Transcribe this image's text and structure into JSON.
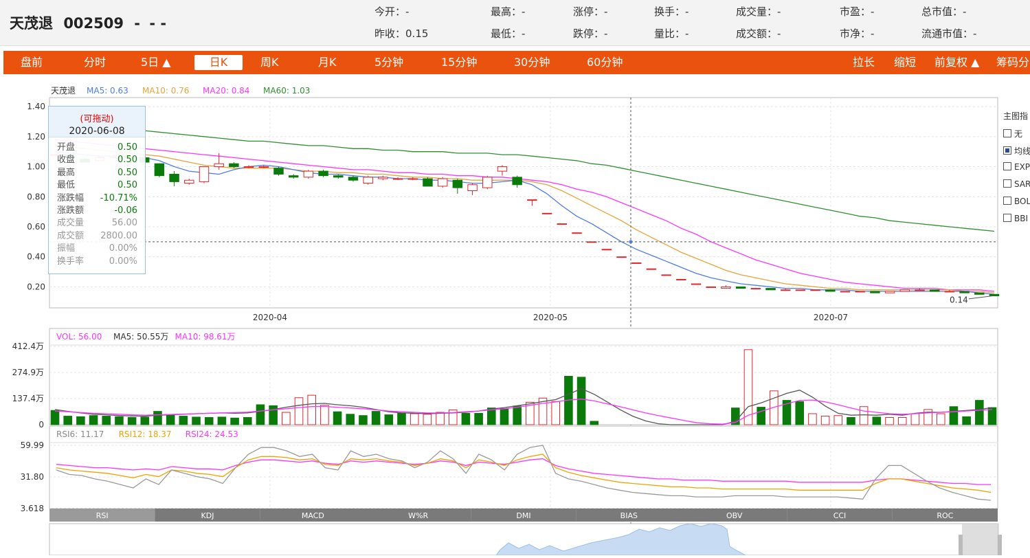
{
  "header": {
    "name": "天茂退",
    "code": "002509",
    "price": "- ",
    "change": "- -",
    "stats": [
      {
        "label": "今开：",
        "value": "-"
      },
      {
        "label": "昨收：",
        "value": "0.15"
      },
      {
        "label": "最高：",
        "value": "-"
      },
      {
        "label": "最低：",
        "value": "-"
      },
      {
        "label": "涨停：",
        "value": "-"
      },
      {
        "label": "跌停：",
        "value": "-"
      },
      {
        "label": "换手：",
        "value": "-"
      },
      {
        "label": "量比：",
        "value": "-"
      },
      {
        "label": "成交量：",
        "value": "-"
      },
      {
        "label": "成交额：",
        "value": "-"
      },
      {
        "label": "市盈：",
        "value": "-"
      },
      {
        "label": "市净：",
        "value": "-"
      },
      {
        "label": "总市值：",
        "value": "-"
      },
      {
        "label": "流通市值：",
        "value": "-"
      }
    ]
  },
  "toolbar": {
    "left": [
      "盘前",
      "分时",
      "5日 ▲",
      "日K",
      "周K",
      "月K",
      "5分钟",
      "15分钟",
      "30分钟",
      "60分钟"
    ],
    "right": [
      "拉长",
      "缩短",
      "前复权 ▲",
      "筹码分"
    ],
    "active": "日K"
  },
  "main_legend": {
    "name": "天茂退",
    "items": [
      {
        "text": "MA5: 0.63",
        "color": "#4d7ce8"
      },
      {
        "text": "MA10: 0.76",
        "color": "#e8a33a"
      },
      {
        "text": "MA20: 0.84",
        "color": "#ff33ff"
      },
      {
        "text": "MA60: 1.03",
        "color": "#2f8f2f"
      }
    ]
  },
  "price_axis": [
    "1.40",
    "1.20",
    "1.00",
    "0.80",
    "0.60",
    "0.40",
    "0.20"
  ],
  "date_axis": [
    "2020-04",
    "2020-05",
    "2020-07"
  ],
  "min_label": "0.14",
  "tooltip": {
    "drag": "(可拖动)",
    "date": "2020-06-08",
    "rows": [
      {
        "label": "开盘",
        "value": "0.50",
        "tone": "down"
      },
      {
        "label": "收盘",
        "value": "0.50",
        "tone": "down"
      },
      {
        "label": "最高",
        "value": "0.50",
        "tone": "down"
      },
      {
        "label": "最低",
        "value": "0.50",
        "tone": "down"
      },
      {
        "label": "涨跌幅",
        "value": "-10.71%",
        "tone": "down"
      },
      {
        "label": "涨跌额",
        "value": "-0.06",
        "tone": "down"
      },
      {
        "label": "成交量",
        "value": "56.00",
        "tone": "dim"
      },
      {
        "label": "成交额",
        "value": "2800.00",
        "tone": "dim"
      },
      {
        "label": "振幅",
        "value": "0.00%",
        "tone": "dim"
      },
      {
        "label": "换手率",
        "value": "0.00%",
        "tone": "dim"
      }
    ]
  },
  "side_panel": {
    "title": "主图指",
    "items": [
      {
        "label": "无",
        "checked": false
      },
      {
        "label": "均线",
        "checked": true
      },
      {
        "label": "EXPMA",
        "checked": false
      },
      {
        "label": "SAR",
        "checked": false
      },
      {
        "label": "BOLL",
        "checked": false
      },
      {
        "label": "BBI",
        "checked": false
      }
    ]
  },
  "vol_legend": [
    {
      "text": "VOL: 56.00",
      "color": "#ff33ff"
    },
    {
      "text": "MA5: 50.55万",
      "color": "#333333"
    },
    {
      "text": "MA10: 98.61万",
      "color": "#ff33ff"
    }
  ],
  "vol_axis": [
    "412.4万",
    "274.9万",
    "137.4万",
    "0"
  ],
  "rsi_legend": [
    {
      "text": "RSI6: 11.17",
      "color": "#888888"
    },
    {
      "text": "RSI12: 18.37",
      "color": "#f0a300"
    },
    {
      "text": "RSI24: 24.53",
      "color": "#ff33ff"
    }
  ],
  "rsi_axis": [
    "59.99",
    "31.80",
    "3.618"
  ],
  "indicator_tabs": [
    "RSI",
    "KDJ",
    "MACD",
    "W%R",
    "DMI",
    "BIAS",
    "OBV",
    "CCI",
    "ROC"
  ],
  "active_indicator": "RSI",
  "colors": {
    "up": "#e0262b",
    "down": "#0a7a0a",
    "accent": "#e9530d"
  },
  "chart_data": {
    "type": "candlestick",
    "dates_visible": [
      "2020-04",
      "2020-05",
      "2020-07"
    ],
    "ohlc": [
      [
        1.08,
        1.08,
        1.08,
        1.08
      ],
      [
        1.07,
        1.06,
        1.08,
        1.06
      ],
      [
        1.05,
        1.03,
        1.06,
        1.03
      ],
      [
        1.04,
        1.06,
        1.07,
        1.04
      ],
      [
        1.06,
        1.07,
        1.08,
        1.06
      ],
      [
        1.07,
        1.06,
        1.08,
        1.06
      ],
      [
        1.06,
        1.03,
        1.07,
        1.03
      ],
      [
        1.02,
        0.94,
        1.02,
        0.93
      ],
      [
        0.95,
        0.9,
        0.97,
        0.87
      ],
      [
        0.89,
        0.91,
        0.92,
        0.88
      ],
      [
        0.9,
        1.0,
        1.0,
        0.89
      ],
      [
        1.0,
        1.02,
        1.09,
        0.98
      ],
      [
        1.02,
        1.0,
        1.03,
        0.99
      ],
      [
        1.0,
        1.0,
        1.01,
        0.99
      ],
      [
        1.0,
        1.0,
        1.01,
        0.99
      ],
      [
        0.99,
        0.95,
        1.0,
        0.94
      ],
      [
        0.94,
        0.93,
        0.95,
        0.92
      ],
      [
        0.93,
        0.97,
        0.98,
        0.92
      ],
      [
        0.97,
        0.94,
        0.98,
        0.93
      ],
      [
        0.94,
        0.93,
        0.95,
        0.92
      ],
      [
        0.93,
        0.91,
        0.94,
        0.9
      ],
      [
        0.89,
        0.93,
        0.94,
        0.88
      ],
      [
        0.92,
        0.93,
        0.94,
        0.91
      ],
      [
        0.92,
        0.92,
        0.93,
        0.91
      ],
      [
        0.92,
        0.92,
        0.93,
        0.91
      ],
      [
        0.92,
        0.87,
        0.93,
        0.87
      ],
      [
        0.87,
        0.92,
        0.93,
        0.86
      ],
      [
        0.91,
        0.86,
        0.92,
        0.82
      ],
      [
        0.84,
        0.88,
        0.89,
        0.81
      ],
      [
        0.86,
        0.93,
        0.94,
        0.85
      ],
      [
        0.97,
        1.0,
        1.01,
        0.94
      ],
      [
        0.93,
        0.88,
        0.94,
        0.86
      ],
      [
        0.78,
        0.78,
        0.78,
        0.74
      ],
      [
        0.69,
        0.69,
        0.69,
        0.69
      ],
      [
        0.62,
        0.62,
        0.62,
        0.62
      ],
      [
        0.56,
        0.56,
        0.56,
        0.56
      ],
      [
        0.5,
        0.5,
        0.5,
        0.5
      ],
      [
        0.45,
        0.45,
        0.45,
        0.45
      ],
      [
        0.4,
        0.4,
        0.4,
        0.4
      ],
      [
        0.36,
        0.36,
        0.36,
        0.36
      ],
      [
        0.32,
        0.32,
        0.32,
        0.32
      ],
      [
        0.28,
        0.28,
        0.28,
        0.28
      ],
      [
        0.25,
        0.25,
        0.25,
        0.25
      ],
      [
        0.22,
        0.22,
        0.22,
        0.22
      ],
      [
        0.2,
        0.2,
        0.2,
        0.2
      ],
      [
        0.19,
        0.2,
        0.21,
        0.19
      ],
      [
        0.2,
        0.19,
        0.2,
        0.19
      ],
      [
        0.19,
        0.19,
        0.19,
        0.19
      ],
      [
        0.19,
        0.18,
        0.19,
        0.18
      ],
      [
        0.18,
        0.18,
        0.19,
        0.18
      ],
      [
        0.18,
        0.18,
        0.18,
        0.18
      ],
      [
        0.18,
        0.18,
        0.18,
        0.18
      ],
      [
        0.18,
        0.17,
        0.18,
        0.17
      ],
      [
        0.17,
        0.17,
        0.17,
        0.17
      ],
      [
        0.17,
        0.17,
        0.17,
        0.17
      ],
      [
        0.17,
        0.16,
        0.17,
        0.16
      ],
      [
        0.16,
        0.17,
        0.17,
        0.16
      ],
      [
        0.17,
        0.18,
        0.18,
        0.17
      ],
      [
        0.18,
        0.18,
        0.19,
        0.18
      ],
      [
        0.18,
        0.17,
        0.18,
        0.17
      ],
      [
        0.17,
        0.17,
        0.18,
        0.17
      ],
      [
        0.17,
        0.16,
        0.17,
        0.16
      ],
      [
        0.16,
        0.15,
        0.16,
        0.15
      ],
      [
        0.15,
        0.14,
        0.15,
        0.14
      ]
    ],
    "ma5": [
      1.1,
      1.09,
      1.08,
      1.07,
      1.07,
      1.06,
      1.06,
      1.04,
      1.0,
      0.97,
      0.96,
      0.95,
      0.98,
      1.0,
      1.01,
      1.0,
      0.98,
      0.96,
      0.95,
      0.95,
      0.94,
      0.93,
      0.93,
      0.92,
      0.92,
      0.91,
      0.91,
      0.9,
      0.89,
      0.89,
      0.9,
      0.91,
      0.88,
      0.82,
      0.74,
      0.67,
      0.62,
      0.56,
      0.5,
      0.45,
      0.41,
      0.37,
      0.33,
      0.29,
      0.26,
      0.24,
      0.22,
      0.21,
      0.2,
      0.19,
      0.19,
      0.18,
      0.18,
      0.18,
      0.17,
      0.17,
      0.17,
      0.17,
      0.17,
      0.17,
      0.17,
      0.17,
      0.16,
      0.15
    ],
    "ma10": [
      1.14,
      1.13,
      1.12,
      1.11,
      1.1,
      1.09,
      1.08,
      1.07,
      1.05,
      1.03,
      1.01,
      1.0,
      0.99,
      0.99,
      0.99,
      0.99,
      0.98,
      0.97,
      0.97,
      0.96,
      0.96,
      0.95,
      0.95,
      0.94,
      0.93,
      0.93,
      0.92,
      0.92,
      0.91,
      0.91,
      0.91,
      0.91,
      0.9,
      0.88,
      0.84,
      0.79,
      0.74,
      0.69,
      0.64,
      0.58,
      0.53,
      0.48,
      0.43,
      0.39,
      0.35,
      0.31,
      0.28,
      0.26,
      0.24,
      0.22,
      0.21,
      0.2,
      0.19,
      0.19,
      0.18,
      0.18,
      0.18,
      0.18,
      0.18,
      0.18,
      0.18,
      0.17,
      0.17,
      0.16
    ],
    "ma20": [
      1.18,
      1.17,
      1.16,
      1.15,
      1.14,
      1.13,
      1.12,
      1.11,
      1.1,
      1.09,
      1.08,
      1.07,
      1.06,
      1.05,
      1.04,
      1.03,
      1.02,
      1.01,
      1.0,
      0.99,
      0.98,
      0.98,
      0.97,
      0.96,
      0.96,
      0.95,
      0.95,
      0.94,
      0.94,
      0.93,
      0.93,
      0.92,
      0.91,
      0.9,
      0.88,
      0.85,
      0.83,
      0.8,
      0.76,
      0.72,
      0.68,
      0.64,
      0.59,
      0.55,
      0.5,
      0.46,
      0.42,
      0.38,
      0.35,
      0.32,
      0.29,
      0.27,
      0.25,
      0.23,
      0.22,
      0.21,
      0.2,
      0.19,
      0.19,
      0.19,
      0.18,
      0.18,
      0.18,
      0.17
    ],
    "ma60": [
      1.3,
      1.29,
      1.28,
      1.27,
      1.26,
      1.25,
      1.24,
      1.23,
      1.22,
      1.21,
      1.2,
      1.19,
      1.18,
      1.17,
      1.17,
      1.16,
      1.15,
      1.14,
      1.14,
      1.13,
      1.12,
      1.12,
      1.11,
      1.11,
      1.1,
      1.1,
      1.1,
      1.09,
      1.09,
      1.09,
      1.08,
      1.08,
      1.07,
      1.06,
      1.05,
      1.04,
      1.02,
      1.01,
      0.99,
      0.97,
      0.95,
      0.93,
      0.91,
      0.89,
      0.87,
      0.85,
      0.83,
      0.81,
      0.79,
      0.77,
      0.75,
      0.73,
      0.71,
      0.69,
      0.67,
      0.66,
      0.64,
      0.63,
      0.62,
      0.61,
      0.6,
      0.59,
      0.58,
      0.57
    ],
    "volume_wan": [
      75,
      45,
      42,
      48,
      45,
      42,
      38,
      40,
      70,
      52,
      45,
      40,
      38,
      40,
      35,
      38,
      105,
      100,
      65,
      142,
      155,
      102,
      68,
      55,
      48,
      70,
      52,
      62,
      58,
      55,
      65,
      78,
      60,
      60,
      88,
      85,
      98,
      118,
      140,
      122,
      255,
      250,
      18,
      0,
      0,
      0,
      0,
      0,
      0,
      0,
      0,
      0,
      0,
      88,
      395,
      92,
      178,
      128,
      122,
      58,
      45,
      48,
      38,
      95,
      40,
      38,
      38,
      58,
      80,
      58,
      95,
      42,
      128,
      90
    ],
    "vol_ma5": [
      80,
      70,
      62,
      55,
      52,
      48,
      46,
      45,
      50,
      52,
      55,
      58,
      60,
      62,
      60,
      62,
      70,
      80,
      92,
      102,
      110,
      112,
      105,
      100,
      92,
      80,
      68,
      62,
      60,
      58,
      60,
      62,
      66,
      72,
      82,
      90,
      100,
      110,
      122,
      132,
      160,
      190,
      160,
      120,
      80,
      45,
      20,
      5,
      0,
      0,
      0,
      0,
      0,
      18,
      95,
      115,
      140,
      165,
      182,
      145,
      98,
      60,
      50,
      52,
      50,
      55,
      50,
      60,
      66,
      65,
      70,
      75,
      80,
      90
    ],
    "vol_ma10": [
      72,
      68,
      64,
      60,
      58,
      55,
      52,
      50,
      52,
      54,
      56,
      58,
      60,
      62,
      64,
      66,
      72,
      78,
      84,
      90,
      95,
      96,
      92,
      88,
      84,
      78,
      72,
      68,
      65,
      62,
      62,
      64,
      68,
      72,
      78,
      84,
      92,
      102,
      112,
      120,
      130,
      135,
      125,
      110,
      95,
      78,
      62,
      48,
      35,
      22,
      10,
      5,
      3,
      12,
      50,
      70,
      92,
      110,
      128,
      130,
      120,
      105,
      88,
      72,
      65,
      58,
      55,
      58,
      62,
      65,
      68,
      72,
      76,
      80
    ],
    "rsi6": [
      38,
      34,
      33,
      30,
      28,
      25,
      22,
      30,
      25,
      38,
      35,
      32,
      30,
      26,
      40,
      52,
      58,
      58,
      55,
      50,
      52,
      40,
      38,
      55,
      50,
      52,
      48,
      46,
      40,
      45,
      55,
      48,
      35,
      52,
      47,
      38,
      52,
      58,
      60,
      35,
      30,
      28,
      25,
      22,
      20,
      18,
      17,
      16,
      15,
      15,
      14,
      14,
      14,
      15,
      15,
      15,
      15,
      14,
      14,
      14,
      14,
      14,
      13,
      12,
      30,
      42,
      42,
      35,
      28,
      22,
      18,
      15,
      12,
      11
    ],
    "rsi12": [
      40,
      38,
      37,
      36,
      35,
      33,
      31,
      34,
      32,
      38,
      37,
      35,
      34,
      32,
      40,
      47,
      50,
      50,
      49,
      47,
      48,
      43,
      42,
      48,
      47,
      48,
      46,
      45,
      42,
      44,
      48,
      46,
      40,
      47,
      45,
      42,
      47,
      50,
      52,
      40,
      36,
      33,
      31,
      29,
      27,
      26,
      25,
      24,
      23,
      23,
      22,
      22,
      21,
      21,
      21,
      21,
      21,
      21,
      20,
      20,
      20,
      20,
      20,
      20,
      26,
      30,
      30,
      28,
      26,
      24,
      22,
      21,
      20,
      18
    ],
    "rsi24": [
      43,
      42,
      41,
      40,
      40,
      39,
      38,
      39,
      38,
      41,
      40,
      39,
      39,
      38,
      42,
      45,
      47,
      47,
      46,
      45,
      46,
      44,
      43,
      46,
      45,
      46,
      45,
      44,
      43,
      44,
      46,
      45,
      42,
      45,
      44,
      43,
      45,
      47,
      48,
      42,
      39,
      37,
      35,
      34,
      33,
      32,
      31,
      30,
      30,
      29,
      29,
      29,
      28,
      28,
      28,
      28,
      28,
      28,
      27,
      27,
      27,
      27,
      27,
      27,
      29,
      30,
      30,
      29,
      28,
      27,
      26,
      26,
      25,
      25
    ]
  }
}
